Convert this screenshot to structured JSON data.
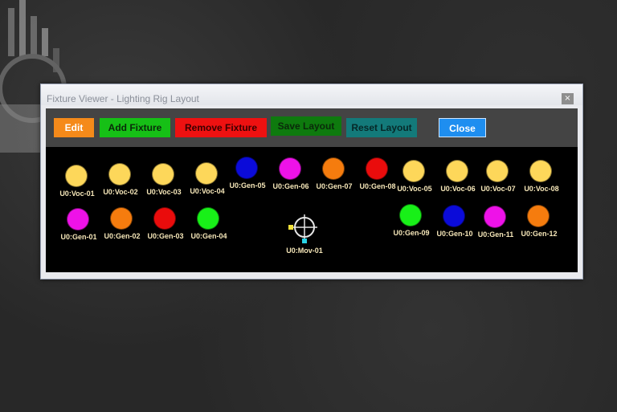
{
  "window": {
    "title": "Fixture Viewer - Lighting Rig Layout",
    "close_glyph": "×"
  },
  "toolbar": {
    "buttons": [
      {
        "label": "Edit",
        "bg": "#f58a1a",
        "fg": "#ffffff"
      },
      {
        "label": "Add Fixture",
        "bg": "#16c016",
        "fg": "#0a2a0a"
      },
      {
        "label": "Remove Fixture",
        "bg": "#ee1111",
        "fg": "#3a0000"
      },
      {
        "label": "Save Layout",
        "bg": "#0e7a0e",
        "fg": "#0a2a0a"
      },
      {
        "label": "Reset Layout",
        "bg": "#137a7a",
        "fg": "#062828"
      },
      {
        "label": "Close",
        "bg": "#1e8ef0",
        "fg": "#ffffff"
      }
    ]
  },
  "fixtures": [
    {
      "label": "U0:Voc-01",
      "color": "#fdd75a"
    },
    {
      "label": "U0:Voc-02",
      "color": "#fdd75a"
    },
    {
      "label": "U0:Voc-03",
      "color": "#fdd75a"
    },
    {
      "label": "U0:Voc-04",
      "color": "#fdd75a"
    },
    {
      "label": "U0:Gen-05",
      "color": "#0b0bd9"
    },
    {
      "label": "U0:Gen-06",
      "color": "#ee12e8"
    },
    {
      "label": "U0:Gen-07",
      "color": "#f57c0e"
    },
    {
      "label": "U0:Gen-08",
      "color": "#ea0c0c"
    },
    {
      "label": "U0:Voc-05",
      "color": "#fdd75a"
    },
    {
      "label": "U0:Voc-06",
      "color": "#fdd75a"
    },
    {
      "label": "U0:Voc-07",
      "color": "#fdd75a"
    },
    {
      "label": "U0:Voc-08",
      "color": "#fdd75a"
    },
    {
      "label": "U0:Gen-01",
      "color": "#ee12e8"
    },
    {
      "label": "U0:Gen-02",
      "color": "#f57c0e"
    },
    {
      "label": "U0:Gen-03",
      "color": "#ea0c0c"
    },
    {
      "label": "U0:Gen-04",
      "color": "#18f018"
    },
    {
      "label": "U0:Gen-09",
      "color": "#18f018"
    },
    {
      "label": "U0:Gen-10",
      "color": "#0b0bd9"
    },
    {
      "label": "U0:Gen-11",
      "color": "#ee12e8"
    },
    {
      "label": "U0:Gen-12",
      "color": "#f57c0e"
    }
  ],
  "mover": {
    "label": "U0:Mov-01",
    "colors": {
      "crosshair": "#e6e6e6",
      "pan_handle": "#f2e23a",
      "tilt_handle": "#2ad4e6"
    }
  },
  "colors": {
    "canvas_bg": "#000000",
    "toolbar_bg": "#444444",
    "label": "#f5e6b8"
  }
}
